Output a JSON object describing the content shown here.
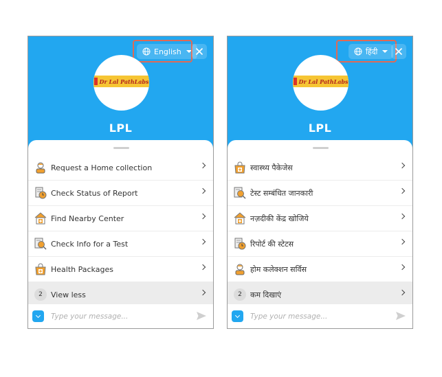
{
  "panels": [
    {
      "language_label": "English",
      "bot_name": "LPL",
      "logo_text": "Dr Lal PathLabs",
      "menu": [
        {
          "label": "Request a Home collection",
          "icon": "home-collection-icon"
        },
        {
          "label": "Check Status of Report",
          "icon": "report-status-icon"
        },
        {
          "label": "Find Nearby Center",
          "icon": "nearby-center-icon"
        },
        {
          "label": "Check Info for a Test",
          "icon": "test-info-icon"
        },
        {
          "label": "Health Packages",
          "icon": "health-packages-icon"
        },
        {
          "label": "View less",
          "badge": "2"
        }
      ],
      "input_placeholder": "Type your message..."
    },
    {
      "language_label": "हिंदी",
      "bot_name": "LPL",
      "logo_text": "Dr Lal PathLabs",
      "menu": [
        {
          "label": "स्वास्थ्य पैकेजेस",
          "icon": "health-packages-icon"
        },
        {
          "label": "टेस्ट सम्बंधित जानकारी",
          "icon": "test-info-icon"
        },
        {
          "label": "नज़दीकी केंद्र खोजिये",
          "icon": "nearby-center-icon"
        },
        {
          "label": "रिपोर्ट की स्टेटस",
          "icon": "report-status-icon"
        },
        {
          "label": "होम कलेक्शन सर्विस",
          "icon": "home-collection-icon"
        },
        {
          "label": "कम दिखाएं",
          "badge": "2"
        }
      ],
      "input_placeholder": "Type your message..."
    }
  ],
  "colors": {
    "header_blue": "#22a7f0",
    "highlight": "#e06a55",
    "icon_orange": "#f0a030",
    "logo_yellow": "#f6c533"
  }
}
